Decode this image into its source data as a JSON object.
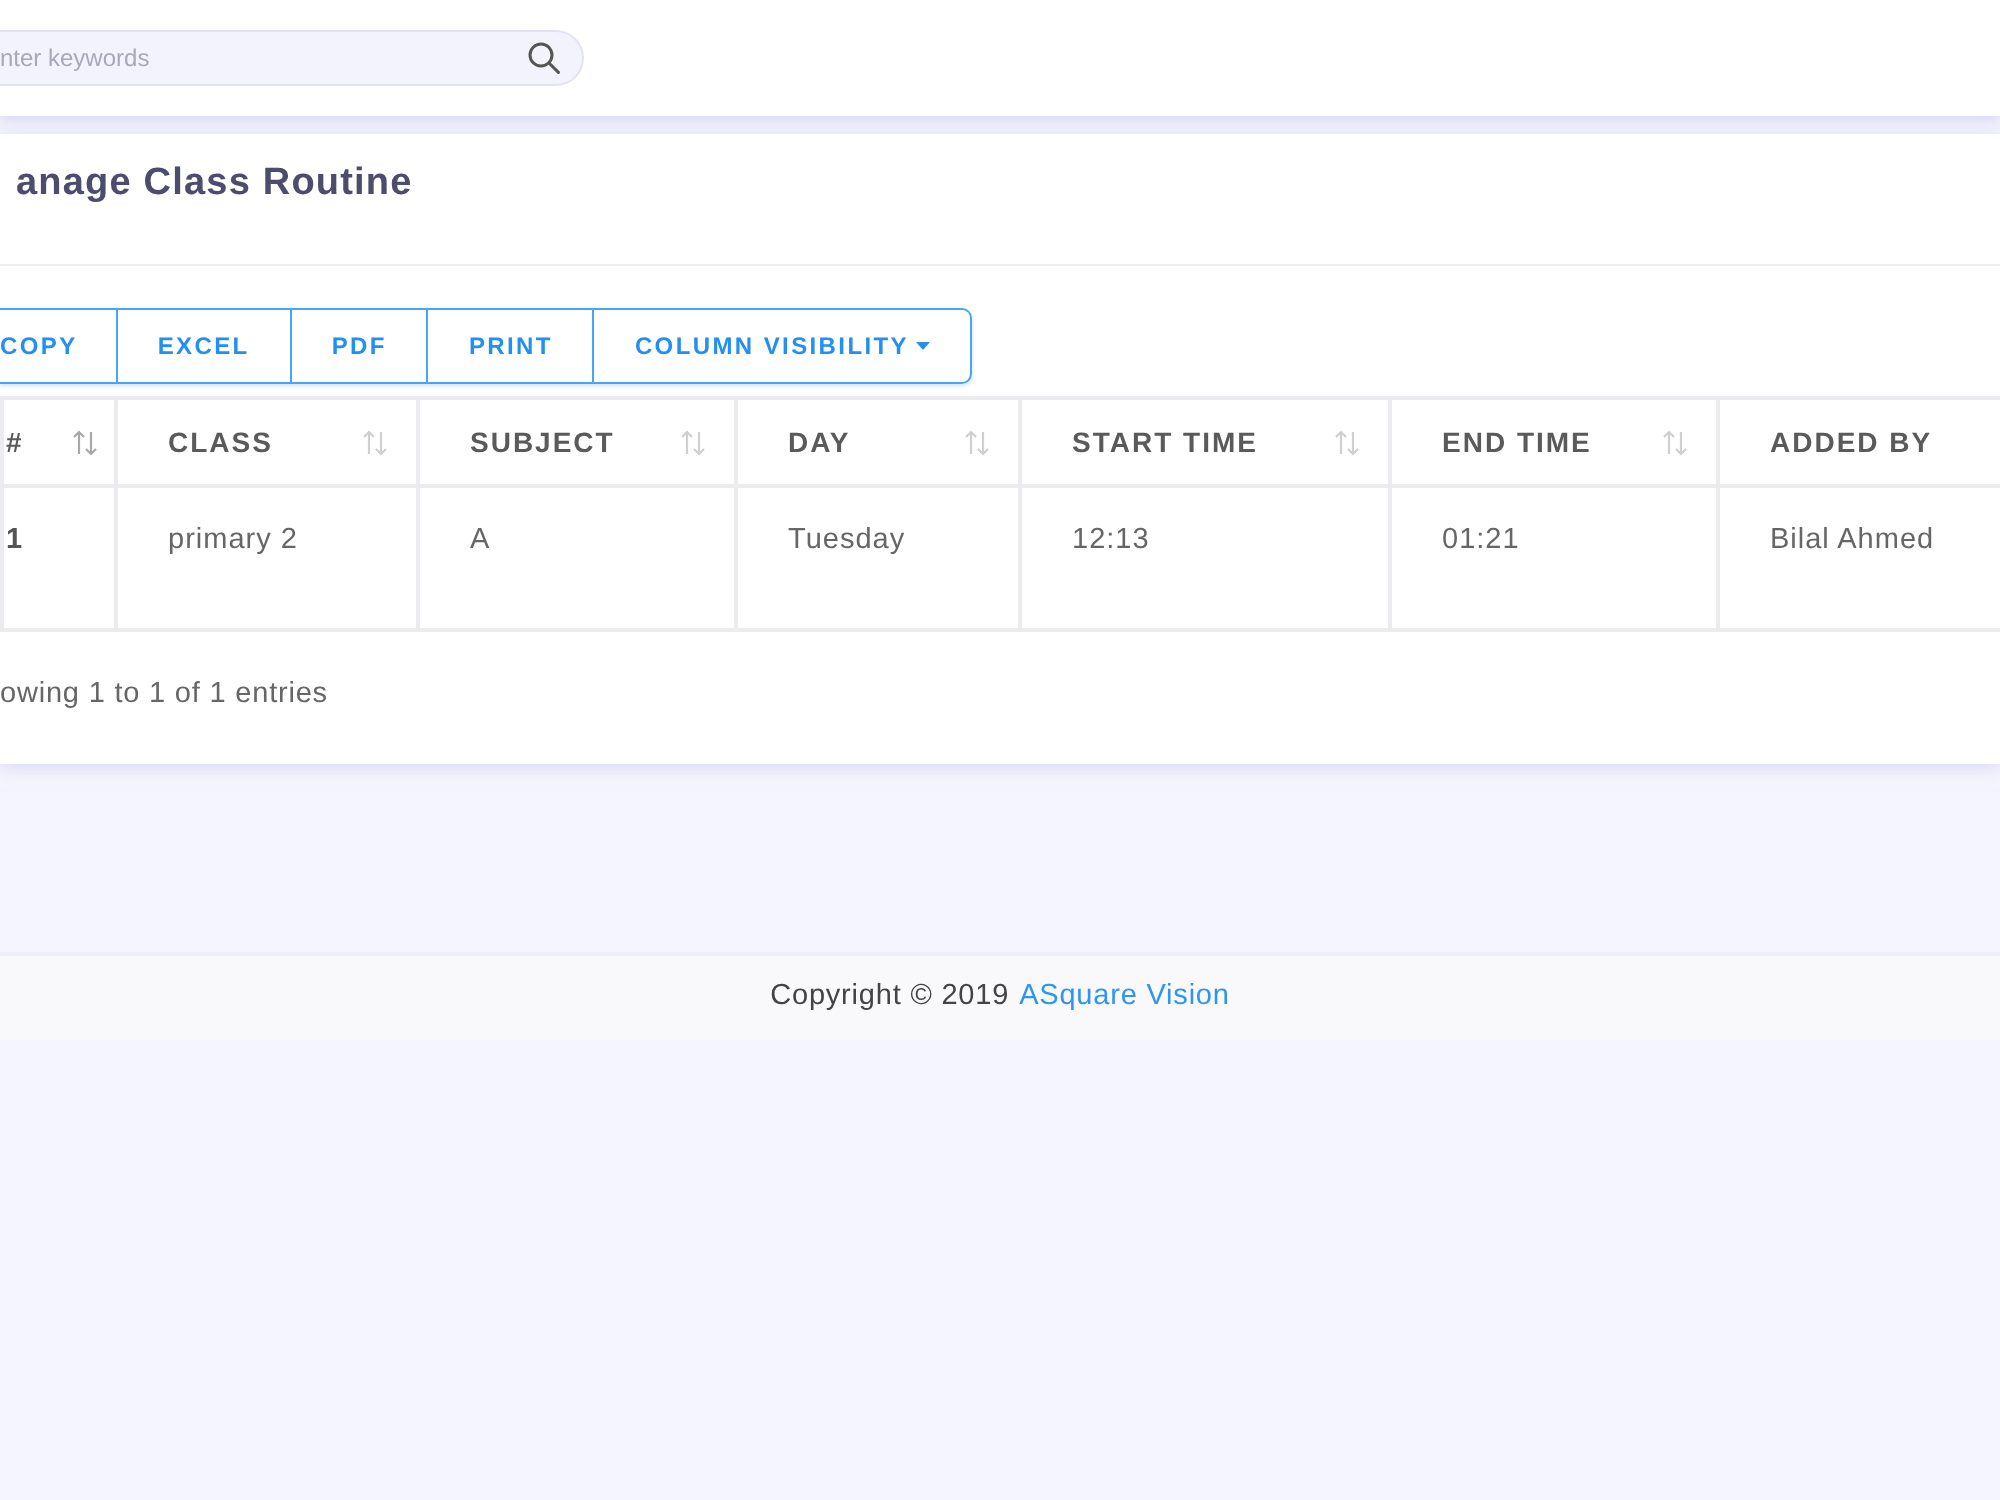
{
  "search": {
    "placeholder": "nter keywords"
  },
  "card": {
    "title": "anage Class Routine"
  },
  "export_buttons": [
    {
      "label": "COPY",
      "kind": "plain"
    },
    {
      "label": "EXCEL",
      "kind": "plain"
    },
    {
      "label": "PDF",
      "kind": "plain"
    },
    {
      "label": "PRINT",
      "kind": "plain"
    },
    {
      "label": "COLUMN VISIBILITY",
      "kind": "dropdown"
    }
  ],
  "table": {
    "columns": [
      {
        "label": "#",
        "sort_icon": true
      },
      {
        "label": "CLASS",
        "sort_icon": true
      },
      {
        "label": "SUBJECT",
        "sort_icon": true
      },
      {
        "label": "DAY",
        "sort_icon": true
      },
      {
        "label": "START TIME",
        "sort_icon": true
      },
      {
        "label": "END TIME",
        "sort_icon": true
      },
      {
        "label": "ADDED BY",
        "sort_icon": false
      }
    ],
    "rows": [
      [
        "1",
        "primary 2",
        "A",
        "Tuesday",
        "12:13",
        "01:21",
        "Bilal Ahmed"
      ]
    ]
  },
  "table_info": "owing 1 to 1 of 1 entries",
  "footer": {
    "text": "Copyright © 2019",
    "link": "ASquare Vision"
  }
}
